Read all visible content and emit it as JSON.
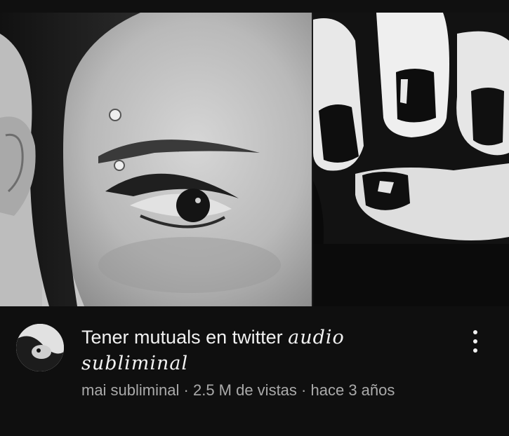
{
  "video": {
    "title_plain": "Tener mutuals en twitter",
    "title_script_line1": "audio",
    "title_script_line2": "subliminal",
    "channel_name": "mai subliminal",
    "separator": "·",
    "views": "2.5 M de vistas",
    "age": "hace 3 años"
  },
  "icons": {
    "menu": "more-vert-icon",
    "avatar": "channel-avatar"
  },
  "colors": {
    "background": "#0f0f0f",
    "title_text": "#f1f1f1",
    "secondary_text": "#aaaaaa"
  }
}
